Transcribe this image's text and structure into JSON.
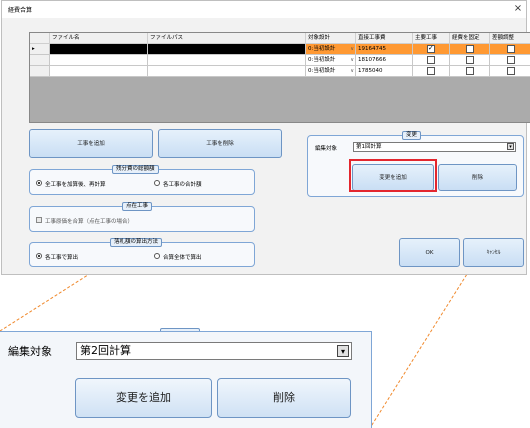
{
  "dialog": {
    "title": "経費合算",
    "close_glyph": "×"
  },
  "grid": {
    "headers": [
      "ファイル名",
      "ファイルパス",
      "対象設計",
      "直接工事費",
      "主要工事",
      "経費を固定",
      "差額調整"
    ],
    "rows": [
      {
        "marker": "▸",
        "design": "0:当初設計",
        "cost": "19164745",
        "main": true,
        "fixed": false,
        "adjust": false,
        "selected": true
      },
      {
        "marker": "",
        "design": "0:当初設計",
        "cost": "18107666",
        "main": false,
        "fixed": false,
        "adjust": false,
        "selected": false
      },
      {
        "marker": "",
        "design": "0:当初設計",
        "cost": "1785040",
        "main": false,
        "fixed": false,
        "adjust": false,
        "selected": false
      }
    ],
    "dropdown_glyph": "∨"
  },
  "buttons": {
    "add_work": "工事を追加",
    "delete_work": "工事を削除",
    "ok": "OK",
    "cancel": "ｷｬﾝｾﾙ"
  },
  "groups": {
    "expense_calc": {
      "title": "残分費の総額額",
      "option1": "全工事を加算後、再計算",
      "option2": "各工事の合計額"
    },
    "work_point": {
      "title": "点在工事",
      "checkbox": "工事原価を合算（点在工事の場合）"
    },
    "bid_method": {
      "title": "落札額の算出方法",
      "option1": "各工事で算出",
      "option2": "合算全体で算出"
    }
  },
  "change_panel": {
    "title": "変更",
    "edit_target_label": "編集対象",
    "edit_target_value": "第1回計算",
    "add_change": "変更を追加",
    "delete": "削除"
  },
  "zoom_panel": {
    "edit_target_label": "編集対象",
    "edit_target_value": "第2回計算",
    "add_change": "変更を追加",
    "delete": "削除"
  },
  "colors": {
    "selected_row": "#ff9933",
    "highlight_box": "#e3262e",
    "callout_line": "#f08a2e",
    "button_border": "#6e95c4"
  }
}
